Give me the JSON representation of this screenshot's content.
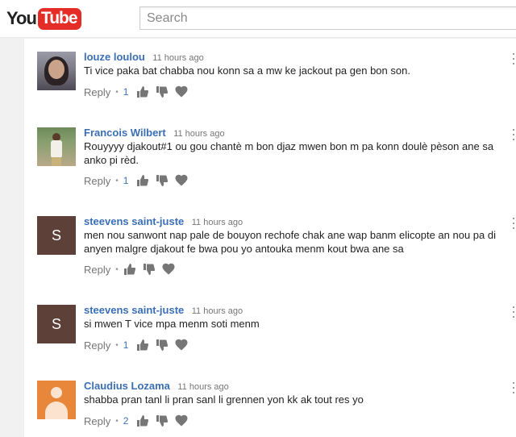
{
  "header": {
    "logo_you": "You",
    "logo_tube": "Tube",
    "search_placeholder": "Search"
  },
  "comments": [
    {
      "author": "louze loulou",
      "time": "11 hours ago",
      "text": "Ti vice paka bat chabba nou konn sa a mw ke jackout pa gen bon son.",
      "reply_label": "Reply",
      "likes": "1",
      "avatar": "photo"
    },
    {
      "author": "Francois Wilbert",
      "time": "11 hours ago",
      "text": "Rouyyyy djakout#1 ou gou chantè m bon djaz mwen bon m pa konn doulè pèson ane sa anko pi rèd.",
      "reply_label": "Reply",
      "likes": "1",
      "avatar": "photo"
    },
    {
      "author": "steevens saint-juste",
      "time": "11 hours ago",
      "text": "men nou sanwont nap pale de bouyon rechofe chak ane wap banm elicopte an nou pa di anyen malgre djakout fe bwa pou yo antouka menm kout bwa ane sa",
      "reply_label": "Reply",
      "likes": "",
      "avatar_letter": "S",
      "avatar_color": "#5d4037"
    },
    {
      "author": "steevens saint-juste",
      "time": "11 hours ago",
      "text": "si mwen T vice mpa menm soti menm",
      "reply_label": "Reply",
      "likes": "1",
      "avatar_letter": "S",
      "avatar_color": "#5d4037"
    },
    {
      "author": "Claudius Lozama",
      "time": "11 hours ago",
      "text": "shabba pran tanl li pran sanl li grennen yon kk ak tout res yo",
      "reply_label": "Reply",
      "likes": "2",
      "avatar": "default",
      "avatar_color": "#e8863a"
    }
  ],
  "icons": [
    "thumbs-up-icon",
    "thumbs-down-icon",
    "heart-icon",
    "more-options-icon"
  ],
  "colors": {
    "author_link": "#3a6eb5",
    "logo_red": "#e52d27",
    "meta_gray": "#767676"
  }
}
